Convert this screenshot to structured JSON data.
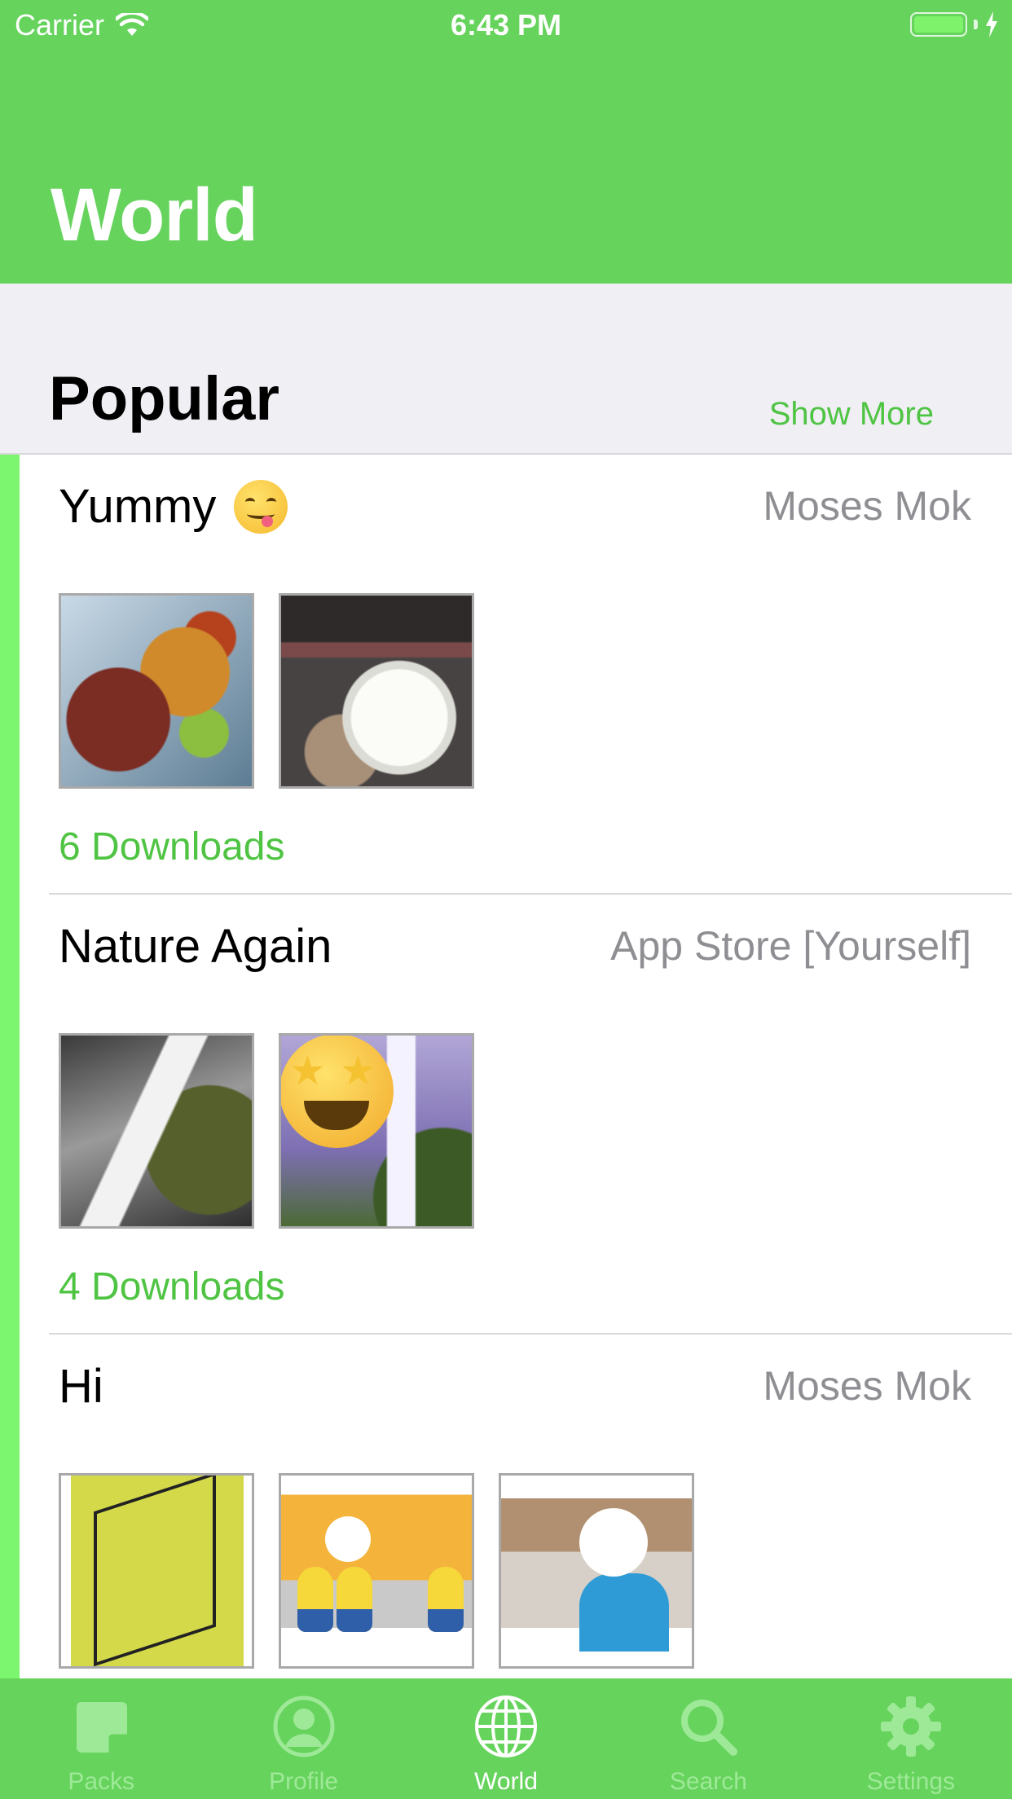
{
  "status_bar": {
    "carrier": "Carrier",
    "time": "6:43 PM"
  },
  "header": {
    "title": "World"
  },
  "section": {
    "title": "Popular",
    "show_more_label": "Show More"
  },
  "packs": [
    {
      "title": "Yummy",
      "title_emoji": "yum-face-icon",
      "author": "Moses Mok",
      "downloads": "6 Downloads",
      "thumbnails": [
        "food-ribs-fries-photo",
        "food-rice-bowl-photo"
      ]
    },
    {
      "title": "Nature Again",
      "author": "App Store [Yourself]",
      "downloads": "4 Downloads",
      "thumbnails": [
        "waterfall-photo",
        "star-struck-waterfall-sticker"
      ]
    },
    {
      "title": "Hi",
      "author": "Moses Mok",
      "thumbnails": [
        "hi-drawing-photo",
        "minions-photo",
        "restaurant-kid-photo"
      ]
    }
  ],
  "tab_bar": {
    "tabs": [
      {
        "label": "Packs",
        "icon": "sticker-icon"
      },
      {
        "label": "Profile",
        "icon": "person-icon"
      },
      {
        "label": "World",
        "icon": "globe-icon",
        "active": true
      },
      {
        "label": "Search",
        "icon": "search-icon"
      },
      {
        "label": "Settings",
        "icon": "gear-icon"
      }
    ]
  },
  "colors": {
    "brand_green": "#66d35d",
    "accent_green": "#4fc443",
    "accent_bar": "#7cf56f",
    "secondary_text": "#8e8e93"
  }
}
